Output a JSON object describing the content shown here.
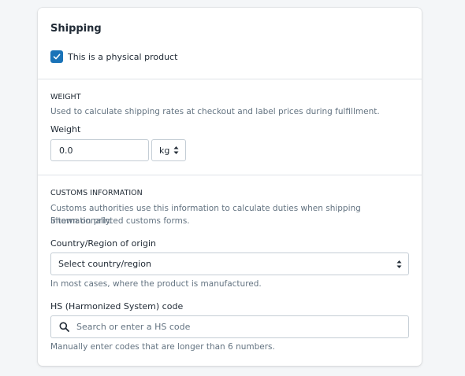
{
  "card": {
    "title": "Shipping",
    "physical_product": {
      "label": "This is a physical product",
      "checked": true
    }
  },
  "weight": {
    "heading": "WEIGHT",
    "help": "Used to calculate shipping rates at checkout and label prices during fulfillment.",
    "field_label": "Weight",
    "value": "0.0",
    "unit": "kg"
  },
  "customs": {
    "heading": "CUSTOMS INFORMATION",
    "help_line1": "Customs authorities use this information to calculate duties when shipping internationally.",
    "help_line2": "Shown on printed customs forms.",
    "country_label": "Country/Region of origin",
    "country_value": "Select country/region",
    "country_help": "In most cases, where the product is manufactured.",
    "hs_label": "HS (Harmonized System) code",
    "hs_placeholder": "Search or enter a HS code",
    "hs_help": "Manually enter codes that are longer than 6 numbers."
  },
  "colors": {
    "accent": "#1a73b8",
    "border": "#c4cdd5",
    "divider": "#dfe3e8",
    "muted_text": "#637381"
  }
}
